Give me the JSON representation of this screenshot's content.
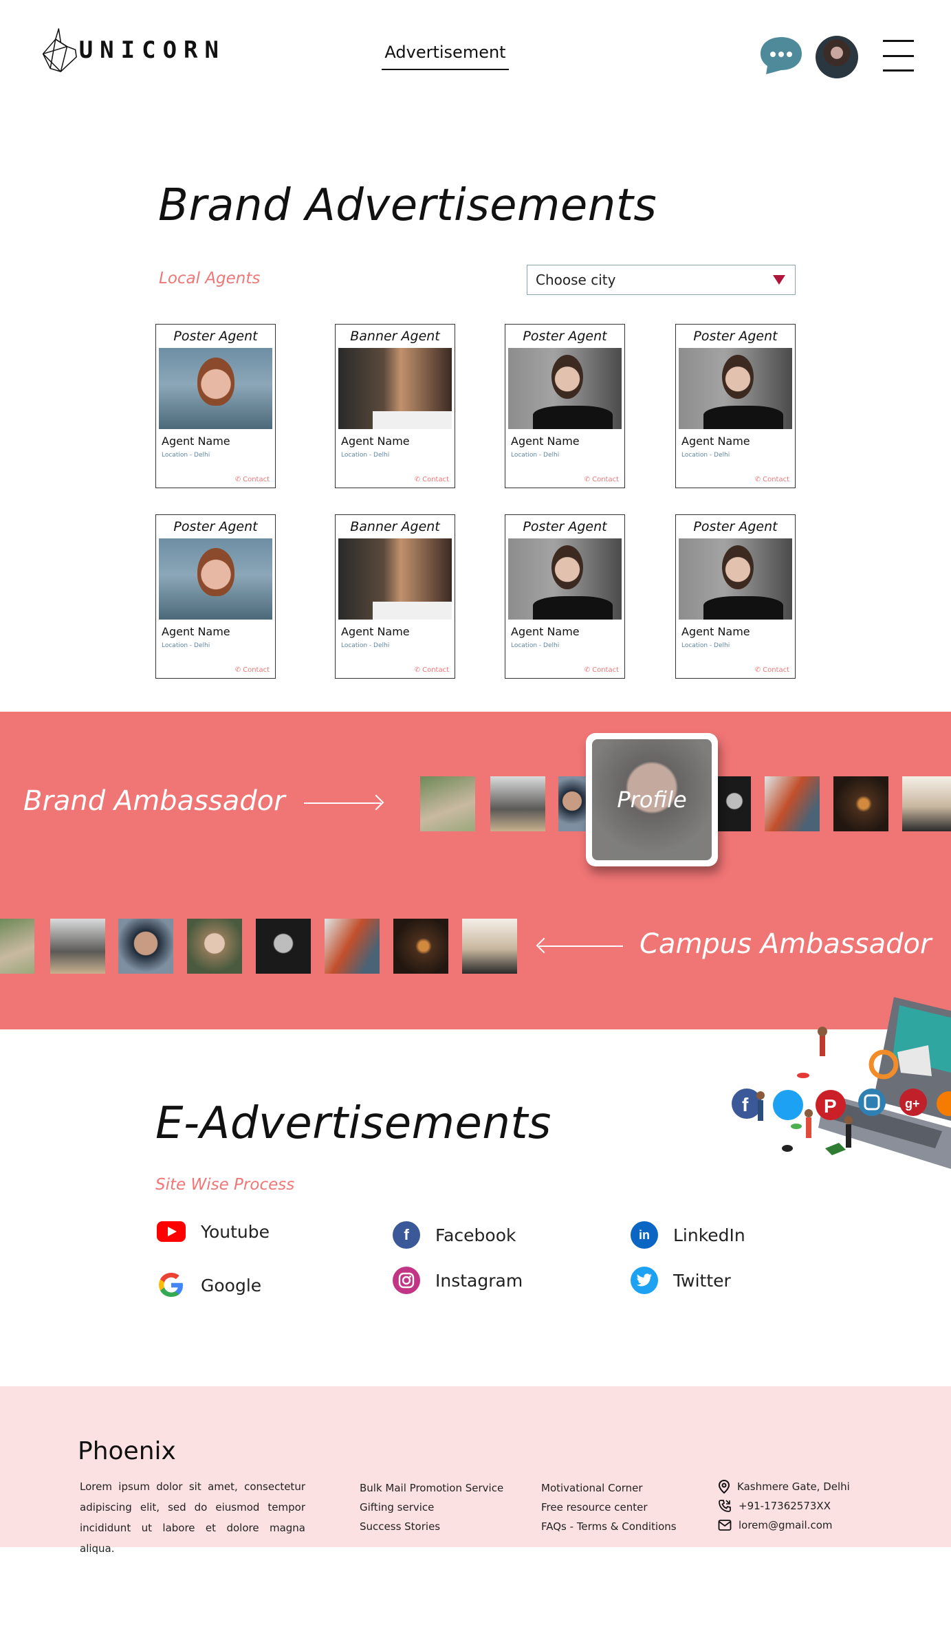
{
  "header": {
    "logo_text": "UNICORN",
    "nav_link": "Advertisement"
  },
  "brand": {
    "title": "Brand Advertisements",
    "subtitle": "Local Agents",
    "city_select": "Choose city",
    "cards": [
      {
        "type": "Poster Agent",
        "name": "Agent Name",
        "location": "Location - Delhi",
        "contact": "Contact"
      },
      {
        "type": "Banner Agent",
        "name": "Agent Name",
        "location": "Location - Delhi",
        "contact": "Contact"
      },
      {
        "type": "Poster Agent",
        "name": "Agent Name",
        "location": "Location - Delhi",
        "contact": "Contact"
      },
      {
        "type": "Poster Agent",
        "name": "Agent Name",
        "location": "Location - Delhi",
        "contact": "Contact"
      },
      {
        "type": "Poster Agent",
        "name": "Agent Name",
        "location": "Location - Delhi",
        "contact": "Contact"
      },
      {
        "type": "Banner Agent",
        "name": "Agent Name",
        "location": "Location - Delhi",
        "contact": "Contact"
      },
      {
        "type": "Poster Agent",
        "name": "Agent Name",
        "location": "Location - Delhi",
        "contact": "Contact"
      },
      {
        "type": "Poster Agent",
        "name": "Agent Name",
        "location": "Location - Delhi",
        "contact": "Contact"
      }
    ]
  },
  "ambassador": {
    "brand_label": "Brand Ambassador",
    "campus_label": "Campus Ambassador",
    "profile_label": "Profile"
  },
  "eads": {
    "title": "E-Advertisements",
    "subtitle": "Site Wise Process",
    "platforms": [
      {
        "label": "Youtube",
        "icon": "youtube-icon",
        "color": "#ff0000"
      },
      {
        "label": "Facebook",
        "icon": "facebook-icon",
        "color": "#3b5998"
      },
      {
        "label": "LinkedIn",
        "icon": "linkedin-icon",
        "color": "#0a66c2"
      },
      {
        "label": "Google",
        "icon": "google-icon",
        "color": "#4285f4"
      },
      {
        "label": "Instagram",
        "icon": "instagram-icon",
        "color": "#c13584"
      },
      {
        "label": "Twitter",
        "icon": "twitter-icon",
        "color": "#1da1f2"
      }
    ]
  },
  "footer": {
    "title": "Phoenix",
    "description": "Lorem ipsum dolor sit amet, consectetur adipiscing elit, sed do eiusmod tempor incididunt ut labore et dolore magna aliqua.",
    "col1": [
      "Bulk Mail Promotion Service",
      "Gifting service",
      "Success Stories"
    ],
    "col2": [
      "Motivational Corner",
      "Free resource center",
      "FAQs - Terms & Conditions"
    ],
    "contact": {
      "address": "Kashmere Gate, Delhi",
      "phone": "+91-17362573XX",
      "email": "lorem@gmail.com"
    }
  },
  "colors": {
    "accent": "#f07575",
    "footer_bg": "#fbe1e2",
    "subtitle": "#ef7777"
  }
}
